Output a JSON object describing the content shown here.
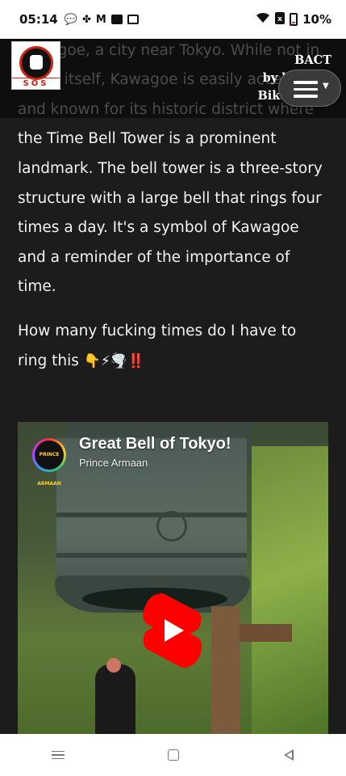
{
  "status_bar": {
    "time": "05:14",
    "notification_icons": [
      "chat-bubble-icon",
      "fan-icon",
      "gmail-icon",
      "news-icon",
      "news-icon"
    ],
    "battery": "10%"
  },
  "header": {
    "logo_text": "SOS",
    "brand_line1": "BACT",
    "brand_line2": "by bikers -",
    "brand_line3": "Bikers ACT"
  },
  "article": {
    "paragraph1_partial": "to the Time Bell Tower (Toki no Kane) in Kawagoe, a city near Tokyo. While not in Tokyo itself, Kawagoe is easily accessible and known for its historic district where the Time Bell Tower is a prominent landmark. The bell tower is a three-story structure with a large bell that rings four times a day. It's a symbol of Kawagoe and a reminder of the importance of time.",
    "paragraph2_text": "How many fucking times do I have to ring this ",
    "paragraph2_emojis": "👇⚡🌪️‼️"
  },
  "video": {
    "title": "Great Bell of Tokyo!",
    "channel": "Prince Armaan",
    "avatar_text": "PRINCE ARMAAN",
    "play_color": "#ff0000"
  }
}
